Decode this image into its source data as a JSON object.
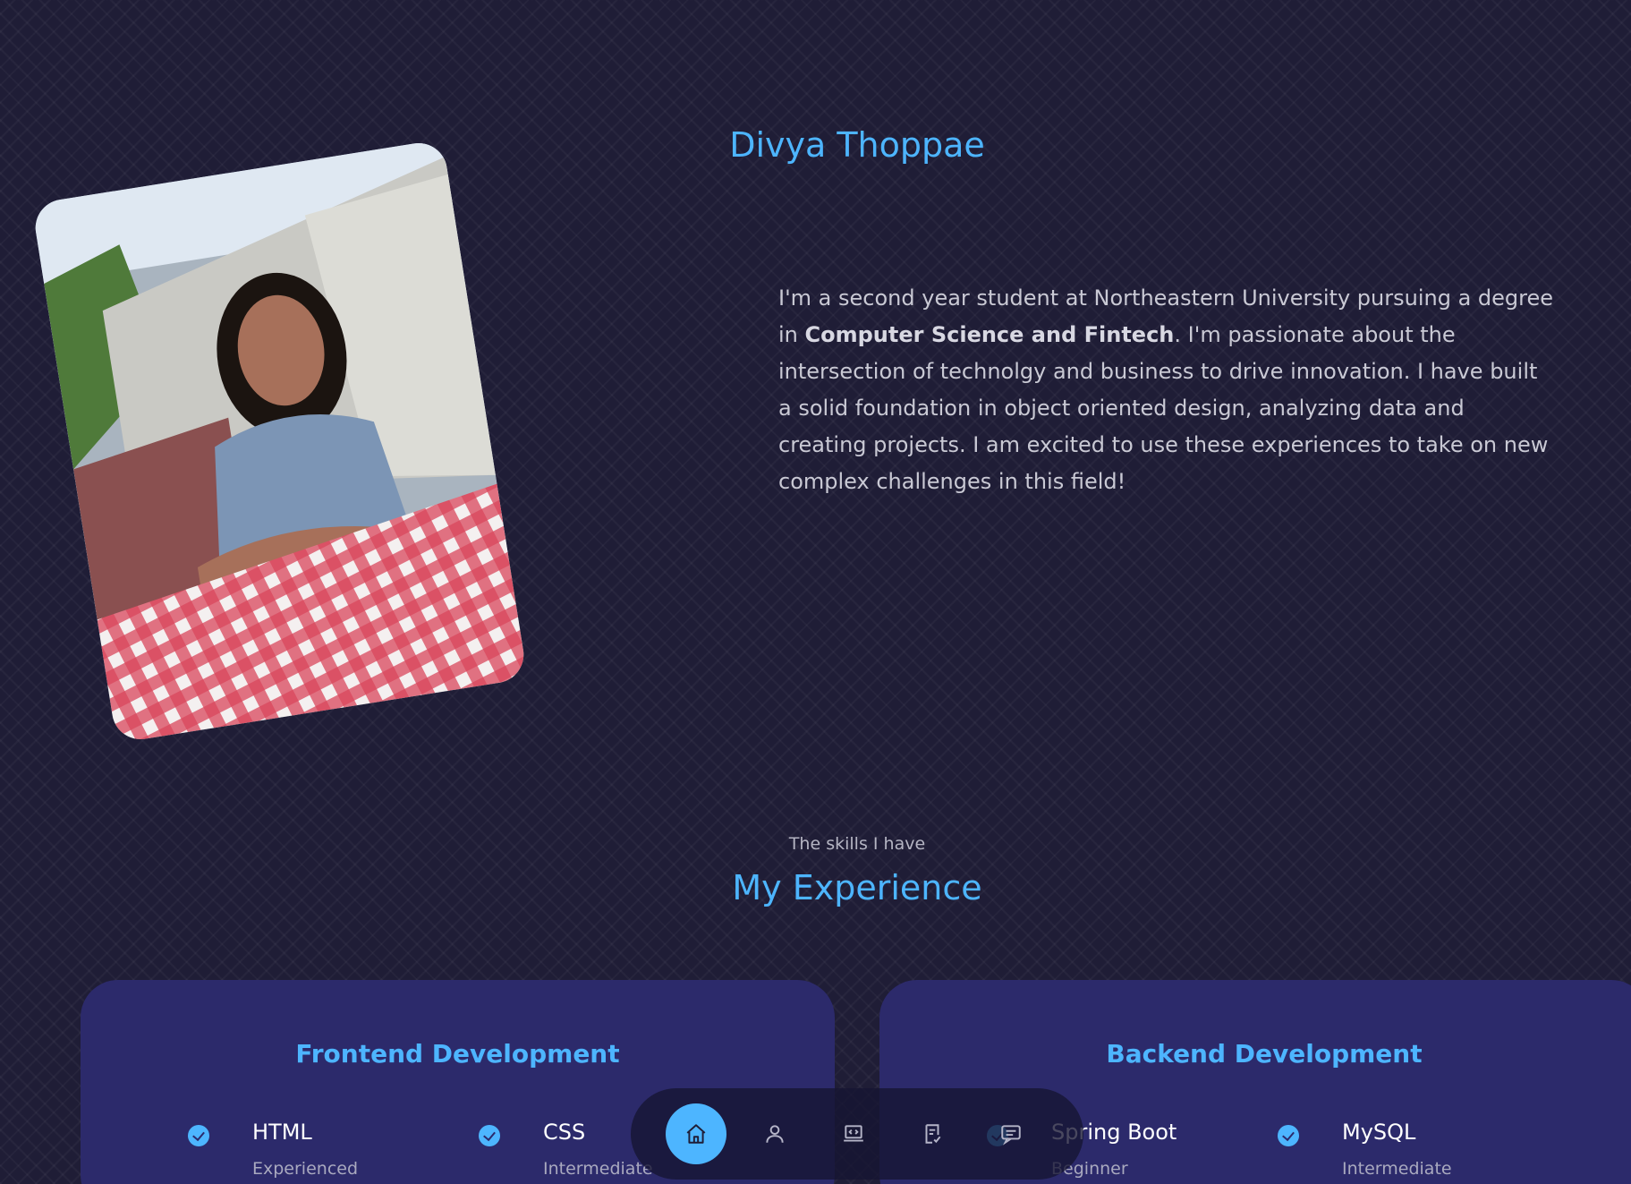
{
  "profile": {
    "name": "Divya Thoppae",
    "about_prefix": "I'm a second year student at Northeastern University pursuing a degree in ",
    "about_bold": "Computer Science and Fintech",
    "about_suffix": ". I'm passionate about the intersection of technolgy and business to drive innovation. I have built a solid foundation in object oriented design, analyzing data and creating projects. I am excited to use these experiences to take on new complex challenges in this field!"
  },
  "experience": {
    "subtitle": "The skills I have",
    "title": "My Experience",
    "frontend": {
      "title": "Frontend Development",
      "skills": [
        {
          "name": "HTML",
          "level": "Experienced"
        },
        {
          "name": "CSS",
          "level": "Intermediate"
        }
      ]
    },
    "backend": {
      "title": "Backend Development",
      "skills": [
        {
          "name": "Spring Boot",
          "level": "Beginner"
        },
        {
          "name": "MySQL",
          "level": "Intermediate"
        }
      ]
    }
  },
  "nav": {
    "items": [
      {
        "icon": "home-icon",
        "active": true
      },
      {
        "icon": "user-icon",
        "active": false
      },
      {
        "icon": "laptop-code-icon",
        "active": false
      },
      {
        "icon": "document-check-icon",
        "active": false
      },
      {
        "icon": "message-icon",
        "active": false
      }
    ]
  },
  "colors": {
    "accent": "#4db5ff",
    "background": "#1f1d36",
    "card": "#2c2a6b"
  }
}
